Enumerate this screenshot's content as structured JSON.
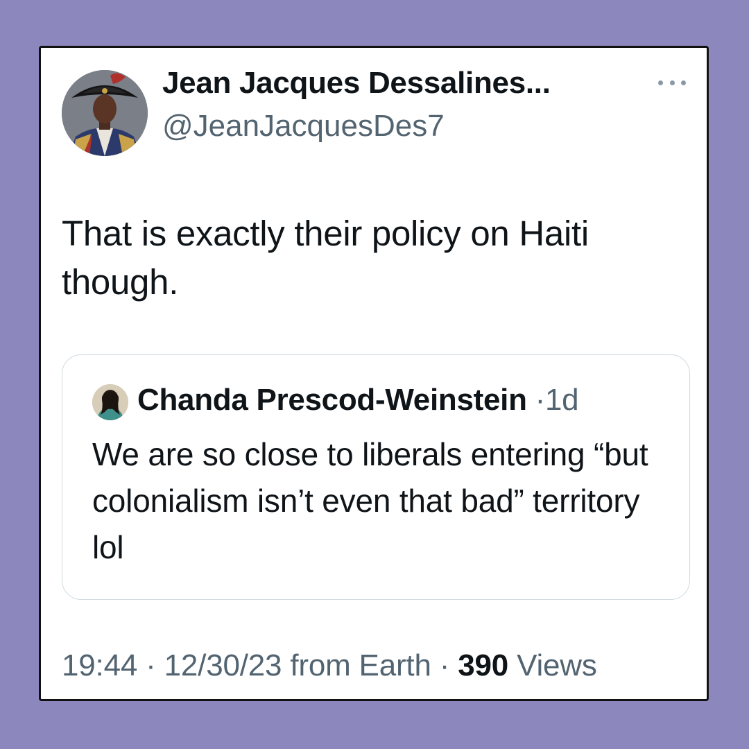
{
  "author": {
    "display_name": "Jean Jacques Dessalines...",
    "handle": "@JeanJacquesDes7",
    "avatar_icon": "portrait-avatar"
  },
  "more_icon": "more-horizontal-icon",
  "tweet": {
    "text": "That is exactly their policy on Haiti though."
  },
  "quoted_tweet": {
    "author_name": "Chanda Prescod-Weinstein",
    "separator": "·",
    "time": "1d",
    "text": "We are so close to liberals entering “but colonialism isn’t even that bad” territory lol"
  },
  "meta": {
    "time": "19:44",
    "sep1": " · ",
    "date": "12/30/23",
    "source": " from Earth",
    "sep2": " · ",
    "views_count": "390",
    "views_label": " Views"
  },
  "colors": {
    "background": "#8c88be",
    "card": "#ffffff",
    "text_primary": "#0f1419",
    "text_secondary": "#536471",
    "quote_border": "#cfd9de"
  }
}
